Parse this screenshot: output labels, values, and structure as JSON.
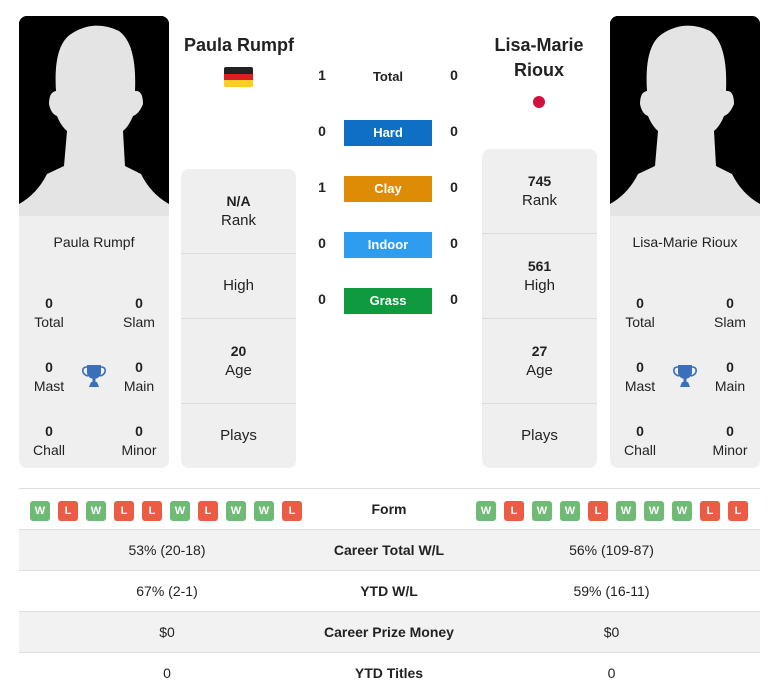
{
  "colors": {
    "hard": "#0e6fc4",
    "clay": "#de8c05",
    "indoor": "#2e9df0",
    "grass": "#109a3f",
    "win": "#6fbb76",
    "loss": "#ec5b44",
    "trophy": "#3a6fba"
  },
  "player1": {
    "name": "Paula Rumpf",
    "country_flag": "germany-flag-icon",
    "card_name": "Paula Rumpf",
    "titles": {
      "total": {
        "value": "0",
        "label": "Total"
      },
      "slam": {
        "value": "0",
        "label": "Slam"
      },
      "mast": {
        "value": "0",
        "label": "Mast"
      },
      "main": {
        "value": "0",
        "label": "Main"
      },
      "chall": {
        "value": "0",
        "label": "Chall"
      },
      "minor": {
        "value": "0",
        "label": "Minor"
      }
    },
    "info": {
      "rank": {
        "value": "N/A",
        "label": "Rank"
      },
      "high": {
        "value": "",
        "label": "High"
      },
      "age": {
        "value": "20",
        "label": "Age"
      },
      "plays": {
        "value": "",
        "label": "Plays"
      }
    },
    "form": [
      "W",
      "L",
      "W",
      "L",
      "L",
      "W",
      "L",
      "W",
      "W",
      "L"
    ]
  },
  "player2": {
    "name": "Lisa-Marie Rioux",
    "name_line1": "Lisa-Marie",
    "name_line2": "Rioux",
    "country_flag": "japan-flag-icon",
    "card_name": "Lisa-Marie Rioux",
    "titles": {
      "total": {
        "value": "0",
        "label": "Total"
      },
      "slam": {
        "value": "0",
        "label": "Slam"
      },
      "mast": {
        "value": "0",
        "label": "Mast"
      },
      "main": {
        "value": "0",
        "label": "Main"
      },
      "chall": {
        "value": "0",
        "label": "Chall"
      },
      "minor": {
        "value": "0",
        "label": "Minor"
      }
    },
    "info": {
      "rank": {
        "value": "745",
        "label": "Rank"
      },
      "high": {
        "value": "561",
        "label": "High"
      },
      "age": {
        "value": "27",
        "label": "Age"
      },
      "plays": {
        "value": "",
        "label": "Plays"
      }
    },
    "form": [
      "W",
      "L",
      "W",
      "W",
      "L",
      "W",
      "W",
      "W",
      "L",
      "L"
    ]
  },
  "h2h": {
    "total": {
      "label": "Total",
      "p1": "1",
      "p2": "0"
    },
    "surfaces": [
      {
        "label": "Hard",
        "p1": "0",
        "p2": "0"
      },
      {
        "label": "Clay",
        "p1": "1",
        "p2": "0"
      },
      {
        "label": "Indoor",
        "p1": "0",
        "p2": "0"
      },
      {
        "label": "Grass",
        "p1": "0",
        "p2": "0"
      }
    ]
  },
  "stats": {
    "form_label": "Form",
    "rows": [
      {
        "label": "Career Total W/L",
        "p1": "53% (20-18)",
        "p2": "56% (109-87)"
      },
      {
        "label": "YTD W/L",
        "p1": "67% (2-1)",
        "p2": "59% (16-11)"
      },
      {
        "label": "Career Prize Money",
        "p1": "$0",
        "p2": "$0"
      },
      {
        "label": "YTD Titles",
        "p1": "0",
        "p2": "0"
      }
    ]
  }
}
